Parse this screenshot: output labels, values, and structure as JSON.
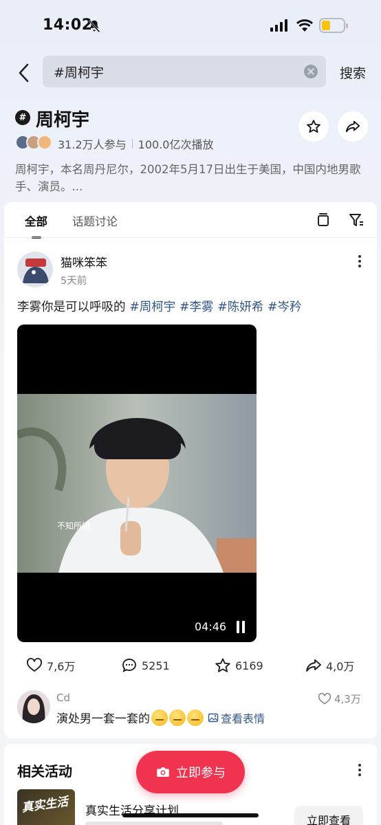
{
  "status_bar": {
    "time": "14:02",
    "battery_level": 0.4,
    "battery_color": "#f6c310"
  },
  "search": {
    "query": "#周柯宇",
    "submit_label": "搜索"
  },
  "topic": {
    "title": "周柯宇",
    "participants": "31.2万人参与",
    "plays": "100.0亿次播放",
    "description": "周柯宇，本名周丹尼尔，2002年5月17日出生于美国，中国内地男歌手、演员。..."
  },
  "tabs": [
    "全部",
    "话题讨论"
  ],
  "post": {
    "username": "猫咪笨笨",
    "time": "5天前",
    "text": "李雾你是可以呼吸的",
    "tags": [
      "#周柯宇",
      "#李雾",
      "#陈妍希",
      "#岑矜"
    ],
    "video": {
      "duration": "04:46",
      "subtitle": "不知所措"
    },
    "likes": "7,6万",
    "comments": "5251",
    "favorites": "6169",
    "shares": "4,0万"
  },
  "top_comment": {
    "username": "Cd",
    "text": "演处男一套一套的",
    "see_emoji_label": "查看表情",
    "likes": "4,3万"
  },
  "related": {
    "title": "相关活动",
    "activity": {
      "name": "真实生活分享计划",
      "thumb_text": "真实生活",
      "button": "立即查看"
    }
  },
  "join_button": "立即参与",
  "colors": {
    "accent": "#f0334f",
    "tag": "#33578a"
  }
}
